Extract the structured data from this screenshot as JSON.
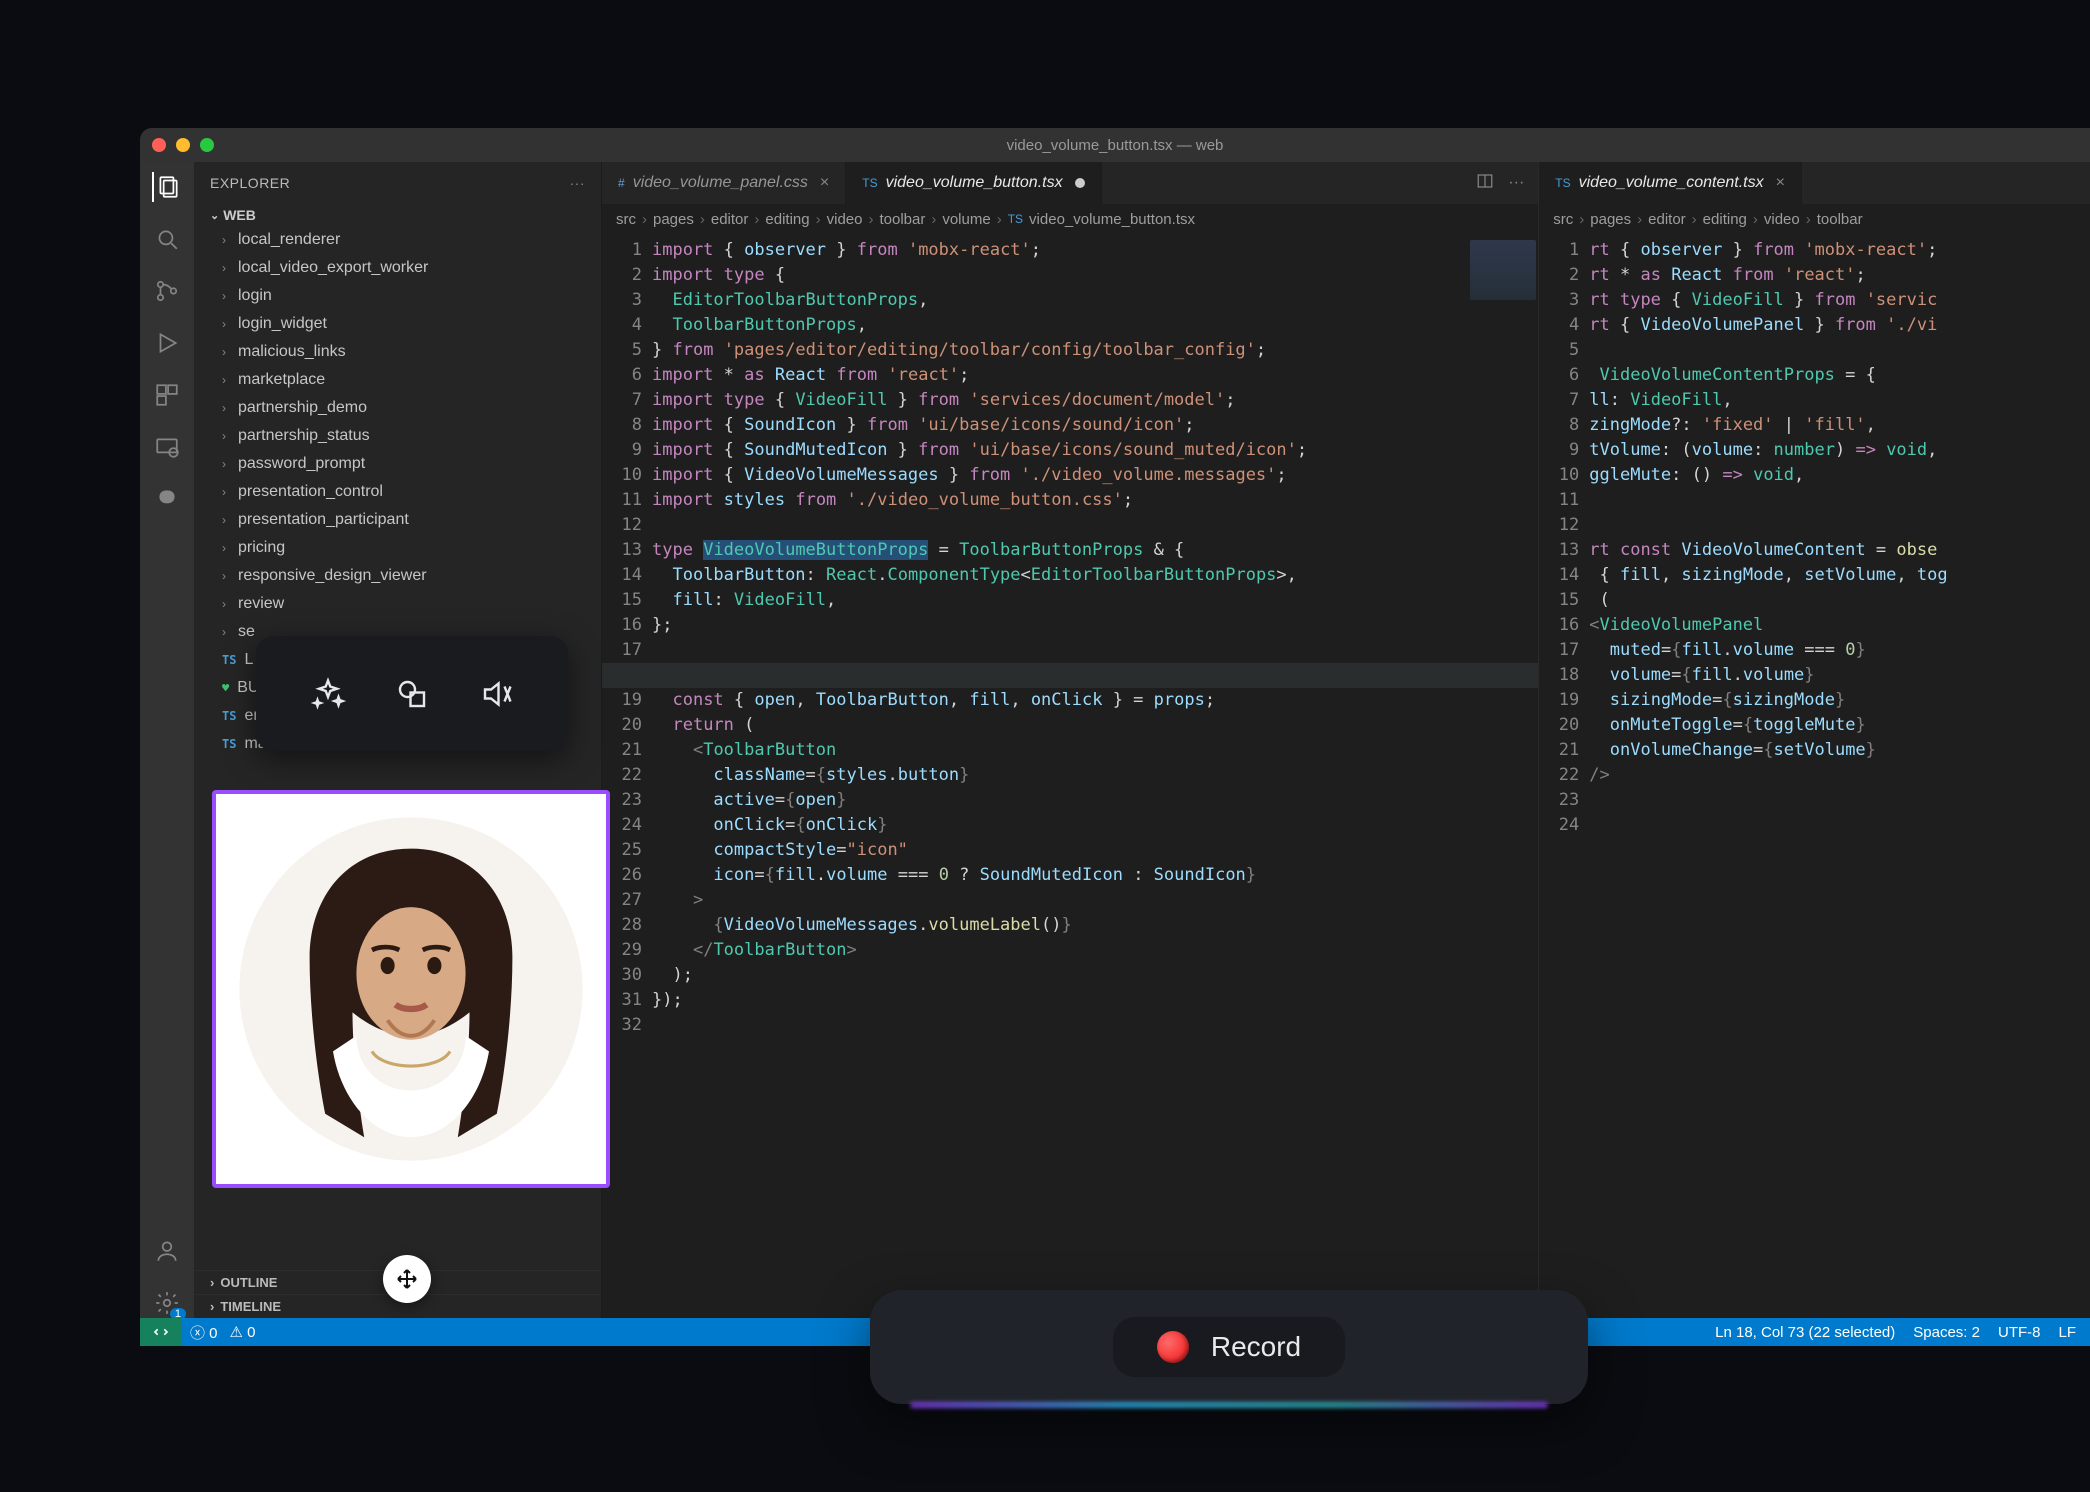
{
  "title": "video_volume_button.tsx — web",
  "sidebar": {
    "header": "EXPLORER",
    "workspace": "WEB",
    "folders": [
      "local_renderer",
      "local_video_export_worker",
      "login",
      "login_widget",
      "malicious_links",
      "marketplace",
      "partnership_demo",
      "partnership_status",
      "password_prompt",
      "presentation_control",
      "presentation_participant",
      "pricing",
      "responsive_design_viewer",
      "review",
      "se"
    ],
    "files": [
      {
        "lang": "ts",
        "name": "L"
      },
      {
        "lang": "heart",
        "name": "BUILD."
      },
      {
        "lang": "ts",
        "name": "entry_point.ts"
      },
      {
        "lang": "ts",
        "name": "main.tsx"
      }
    ],
    "bands": [
      "OUTLINE",
      "TIMELINE"
    ]
  },
  "tabs_left": [
    {
      "label": "video_volume_panel.css",
      "lang": "#",
      "active": false
    },
    {
      "label": "video_volume_button.tsx",
      "lang": "TS",
      "active": true,
      "dirty": true
    }
  ],
  "tabs_right": [
    {
      "label": "video_volume_content.tsx",
      "lang": "TS",
      "active": true
    }
  ],
  "breadcrumbs_left": [
    "src",
    "pages",
    "editor",
    "editing",
    "video",
    "toolbar",
    "volume",
    "video_volume_button.tsx"
  ],
  "breadcrumbs_right": [
    "src",
    "pages",
    "editor",
    "editing",
    "video",
    "toolbar"
  ],
  "statusbar": {
    "errors": "0",
    "warnings": "0",
    "cursor": "Ln 18, Col 73 (22 selected)",
    "spaces": "Spaces: 2",
    "encoding": "UTF-8",
    "eol": "LF",
    "gitbadge": "1"
  },
  "record": {
    "label": "Record"
  },
  "highlight_line": 18
}
